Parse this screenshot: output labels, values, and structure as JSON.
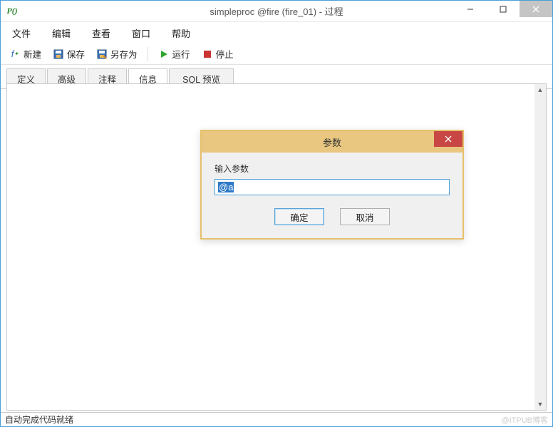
{
  "window": {
    "title": "simpleproc @fire (fire_01) - 过程",
    "app_icon_text": "P()"
  },
  "menu": {
    "file": "文件",
    "edit": "编辑",
    "view": "查看",
    "window": "窗口",
    "help": "帮助"
  },
  "toolbar": {
    "new": "新建",
    "save": "保存",
    "save_as": "另存为",
    "run": "运行",
    "stop": "停止"
  },
  "tabs": {
    "define": "定义",
    "advanced": "高级",
    "comment": "注释",
    "info": "信息",
    "sql_preview": "SQL 预览",
    "active": "信息"
  },
  "dialog": {
    "title": "参数",
    "label": "输入参数",
    "input_value": "@a",
    "ok": "确定",
    "cancel": "取消"
  },
  "statusbar": {
    "text": "自动完成代码就绪",
    "watermark": "@ITPUB博客"
  }
}
